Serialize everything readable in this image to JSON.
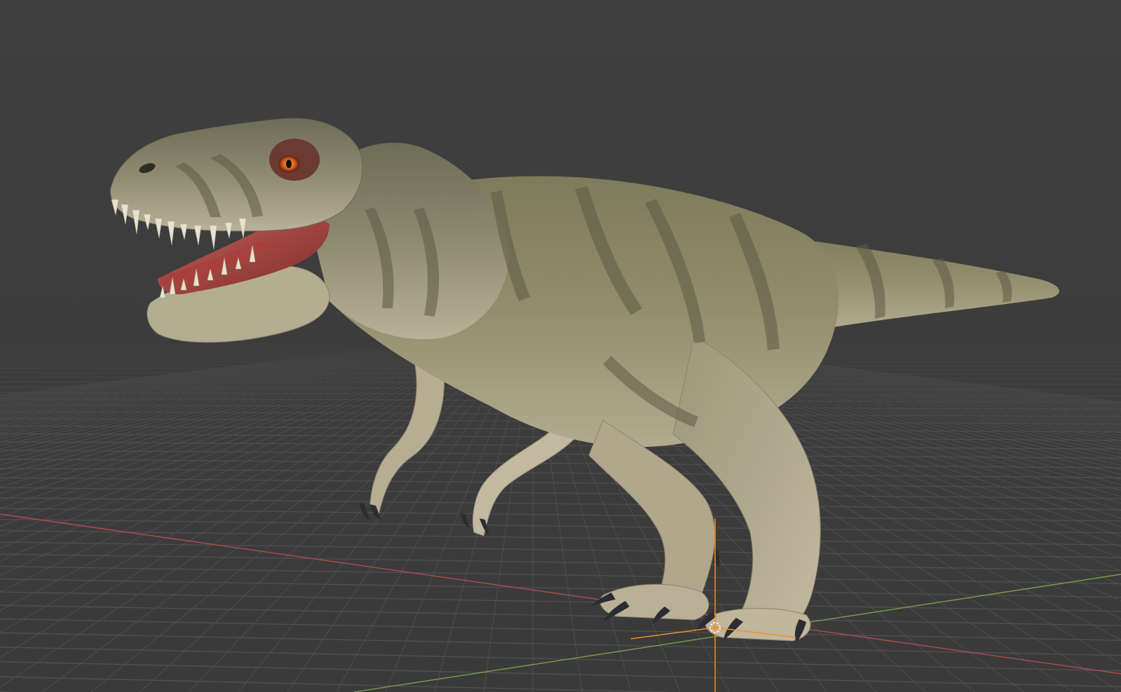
{
  "app": "3D viewport",
  "viewport": {
    "shading_mode": "material-preview",
    "background_color": "#3d3d3d",
    "grid_color": "#505050",
    "x_axis_color": "#b24a4a",
    "y_axis_color": "#7f9a4c",
    "origin_gizmo_color": "#f0902a"
  },
  "scene_object": {
    "name": "tyrannosaurus-model",
    "primary_color": "#8c8766",
    "stripe_color": "#5c5a43",
    "belly_color": "#b5ad92",
    "mouth_color": "#a8413d",
    "eye_color": "#e06a1a",
    "tooth_color": "#e8e2cf",
    "claw_color": "#2b2d33"
  }
}
